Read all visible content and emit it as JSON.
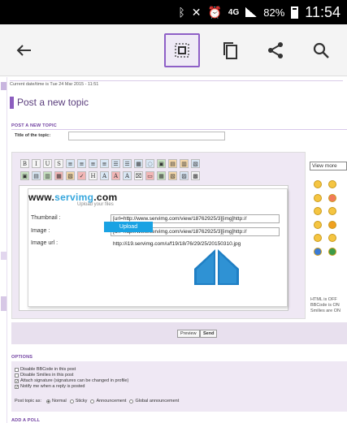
{
  "statusbar": {
    "network": "4G",
    "battery": "82%",
    "time": "11:54",
    "icons": [
      "bluetooth-icon",
      "mute-icon",
      "alarm-icon",
      "signal-icon",
      "battery-icon"
    ]
  },
  "toolbar": {
    "back_icon": "←",
    "select_icon": "⊡",
    "copy_icon": "❐",
    "share_icon": "<",
    "search_icon": "⚲"
  },
  "forum": {
    "datetime": "Current date/time is Tue 24 Mar 2015 - 11:51",
    "heading": "Post a new topic",
    "section_post": "POST A NEW TOPIC",
    "title_label": "Title of the topic:",
    "editor_row1": [
      "B",
      "I",
      "U",
      "S",
      "≡",
      "≡",
      "≡",
      "≡",
      "☰",
      "☰",
      "▦",
      "◌",
      "▣",
      "▤",
      "▥",
      "▧"
    ],
    "editor_row2": [
      "▣",
      "▤",
      "▥",
      "▦",
      "▧",
      "✓",
      "H",
      "A",
      "A",
      "A",
      "⌧",
      "▭",
      "▦",
      "▧",
      "▨",
      "▩"
    ],
    "view_more": "View more",
    "html_status": [
      "HTML is OFF",
      "BBCode is ON",
      "Smilies are ON"
    ],
    "preview_label": "Preview",
    "send_label": "Send",
    "section_options": "OPTIONS",
    "options": [
      {
        "label": "Disable BBCode in this post",
        "checked": false
      },
      {
        "label": "Disable Smilies in this post",
        "checked": false
      },
      {
        "label": "Attach signature (signatures can be changed in profile)",
        "checked": true
      },
      {
        "label": "Notify me when a reply is posted",
        "checked": true
      }
    ],
    "post_topic_as_label": "Post topic as:",
    "post_types": [
      {
        "label": "Normal",
        "selected": true
      },
      {
        "label": "Sticky",
        "selected": false
      },
      {
        "label": "Announcement",
        "selected": false
      },
      {
        "label": "Global announcement",
        "selected": false
      }
    ],
    "section_poll": "ADD A POLL"
  },
  "servimg": {
    "logo_a": "www.",
    "logo_b": "servimg",
    "logo_c": ".com",
    "tagline": "Upload your files",
    "thumbnail_label": "Thumbnail :",
    "thumbnail_value": "[url=http://www.servimg.com/view/18762925/3][img]http://",
    "image_label": "Image :",
    "image_value": "[url=http://www.servimg.com/view/18762925/3][img]http://",
    "image_url_label": "Image url :",
    "image_url_value": "http://i19.servimg.com/u/f19/18/76/29/25/20150310.jpg",
    "upload_label": "Upload"
  }
}
